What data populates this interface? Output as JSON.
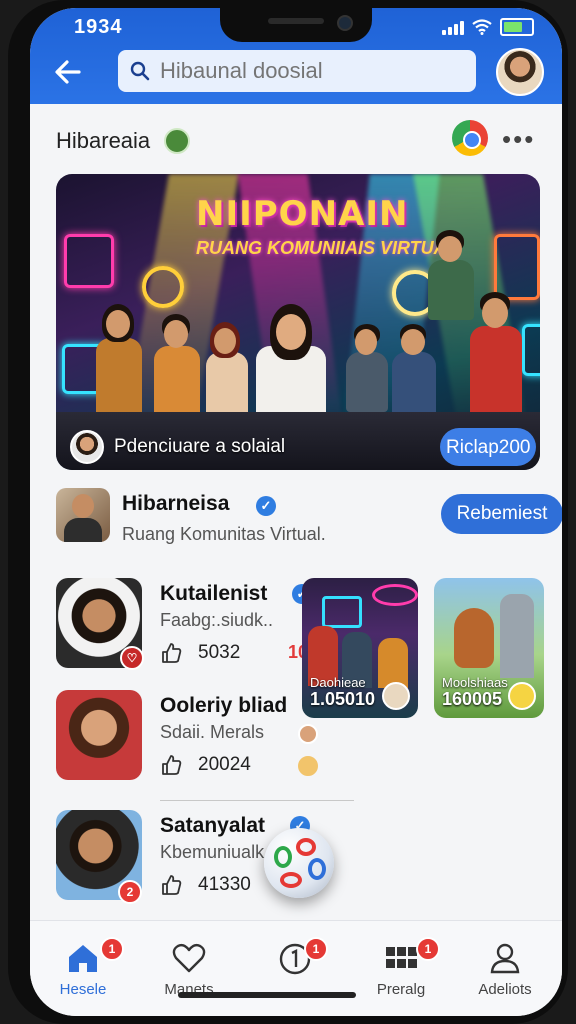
{
  "status": {
    "time": "1934"
  },
  "search": {
    "placeholder": "Hibaunal doosial"
  },
  "page": {
    "title": "Hibareaia"
  },
  "hero": {
    "title": "NIIPONAIN",
    "subtitle": "RUANG KOMUNIIAIS VIRTUAL",
    "caption": "Pdenciuare a solaial",
    "button": "Riclap200"
  },
  "group": {
    "name": "Hibarneisa",
    "description": "Ruang Komunitas Virtual.",
    "join_label": "Rebemiest"
  },
  "posts": [
    {
      "name": "Kutailenist",
      "subtitle": "Faabg:.siudk..",
      "count": "5032",
      "tag": "10",
      "badge": ""
    },
    {
      "name": "Ooleriy bliad",
      "subtitle": "Sdaii. Merals",
      "count": "20024",
      "tag": "",
      "badge": ""
    },
    {
      "name": "Satanyalat",
      "subtitle": "Kbemuniualk..",
      "count": "41330",
      "tag": "",
      "badge": "2"
    }
  ],
  "thumbnails": [
    {
      "label": "Daohieae",
      "value": "1.05010"
    },
    {
      "label": "Moolshiaas",
      "value": "160005"
    }
  ],
  "nav": [
    {
      "label": "Hesele",
      "badge": "1",
      "icon": "home-icon",
      "active": true
    },
    {
      "label": "Manets",
      "badge": "",
      "icon": "heart-icon",
      "active": false
    },
    {
      "label": "",
      "badge": "1",
      "icon": "notification-circle-icon",
      "active": false
    },
    {
      "label": "Preralg",
      "badge": "1",
      "icon": "grid-icon",
      "active": false
    },
    {
      "label": "Adeliots",
      "badge": "",
      "icon": "person-icon",
      "active": false
    }
  ],
  "colors": {
    "primary": "#2b73e6",
    "accent": "#ffd44a",
    "alert": "#e53935"
  }
}
